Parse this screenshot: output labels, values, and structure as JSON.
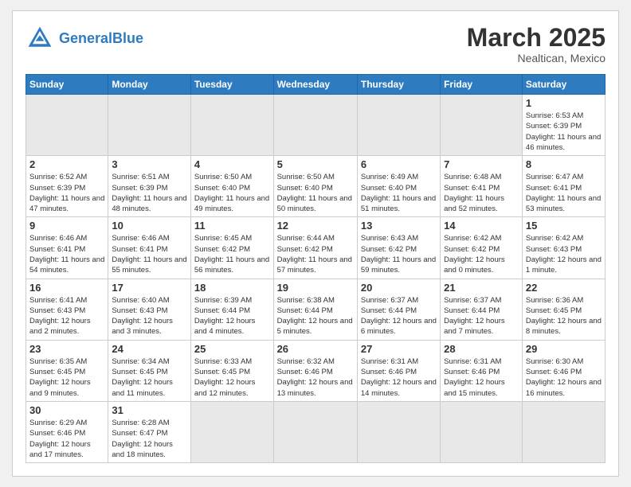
{
  "header": {
    "logo_general": "General",
    "logo_blue": "Blue",
    "month_title": "March 2025",
    "subtitle": "Nealtican, Mexico"
  },
  "weekdays": [
    "Sunday",
    "Monday",
    "Tuesday",
    "Wednesday",
    "Thursday",
    "Friday",
    "Saturday"
  ],
  "weeks": [
    [
      {
        "day": "",
        "empty": true
      },
      {
        "day": "",
        "empty": true
      },
      {
        "day": "",
        "empty": true
      },
      {
        "day": "",
        "empty": true
      },
      {
        "day": "",
        "empty": true
      },
      {
        "day": "",
        "empty": true
      },
      {
        "day": "1",
        "sunrise": "6:53 AM",
        "sunset": "6:39 PM",
        "daylight": "11 hours and 46 minutes."
      }
    ],
    [
      {
        "day": "2",
        "sunrise": "6:52 AM",
        "sunset": "6:39 PM",
        "daylight": "11 hours and 47 minutes."
      },
      {
        "day": "3",
        "sunrise": "6:51 AM",
        "sunset": "6:39 PM",
        "daylight": "11 hours and 48 minutes."
      },
      {
        "day": "4",
        "sunrise": "6:50 AM",
        "sunset": "6:40 PM",
        "daylight": "11 hours and 49 minutes."
      },
      {
        "day": "5",
        "sunrise": "6:50 AM",
        "sunset": "6:40 PM",
        "daylight": "11 hours and 50 minutes."
      },
      {
        "day": "6",
        "sunrise": "6:49 AM",
        "sunset": "6:40 PM",
        "daylight": "11 hours and 51 minutes."
      },
      {
        "day": "7",
        "sunrise": "6:48 AM",
        "sunset": "6:41 PM",
        "daylight": "11 hours and 52 minutes."
      },
      {
        "day": "8",
        "sunrise": "6:47 AM",
        "sunset": "6:41 PM",
        "daylight": "11 hours and 53 minutes."
      }
    ],
    [
      {
        "day": "9",
        "sunrise": "6:46 AM",
        "sunset": "6:41 PM",
        "daylight": "11 hours and 54 minutes."
      },
      {
        "day": "10",
        "sunrise": "6:46 AM",
        "sunset": "6:41 PM",
        "daylight": "11 hours and 55 minutes."
      },
      {
        "day": "11",
        "sunrise": "6:45 AM",
        "sunset": "6:42 PM",
        "daylight": "11 hours and 56 minutes."
      },
      {
        "day": "12",
        "sunrise": "6:44 AM",
        "sunset": "6:42 PM",
        "daylight": "11 hours and 57 minutes."
      },
      {
        "day": "13",
        "sunrise": "6:43 AM",
        "sunset": "6:42 PM",
        "daylight": "11 hours and 59 minutes."
      },
      {
        "day": "14",
        "sunrise": "6:42 AM",
        "sunset": "6:42 PM",
        "daylight": "12 hours and 0 minutes."
      },
      {
        "day": "15",
        "sunrise": "6:42 AM",
        "sunset": "6:43 PM",
        "daylight": "12 hours and 1 minute."
      }
    ],
    [
      {
        "day": "16",
        "sunrise": "6:41 AM",
        "sunset": "6:43 PM",
        "daylight": "12 hours and 2 minutes."
      },
      {
        "day": "17",
        "sunrise": "6:40 AM",
        "sunset": "6:43 PM",
        "daylight": "12 hours and 3 minutes."
      },
      {
        "day": "18",
        "sunrise": "6:39 AM",
        "sunset": "6:44 PM",
        "daylight": "12 hours and 4 minutes."
      },
      {
        "day": "19",
        "sunrise": "6:38 AM",
        "sunset": "6:44 PM",
        "daylight": "12 hours and 5 minutes."
      },
      {
        "day": "20",
        "sunrise": "6:37 AM",
        "sunset": "6:44 PM",
        "daylight": "12 hours and 6 minutes."
      },
      {
        "day": "21",
        "sunrise": "6:37 AM",
        "sunset": "6:44 PM",
        "daylight": "12 hours and 7 minutes."
      },
      {
        "day": "22",
        "sunrise": "6:36 AM",
        "sunset": "6:45 PM",
        "daylight": "12 hours and 8 minutes."
      }
    ],
    [
      {
        "day": "23",
        "sunrise": "6:35 AM",
        "sunset": "6:45 PM",
        "daylight": "12 hours and 9 minutes."
      },
      {
        "day": "24",
        "sunrise": "6:34 AM",
        "sunset": "6:45 PM",
        "daylight": "12 hours and 11 minutes."
      },
      {
        "day": "25",
        "sunrise": "6:33 AM",
        "sunset": "6:45 PM",
        "daylight": "12 hours and 12 minutes."
      },
      {
        "day": "26",
        "sunrise": "6:32 AM",
        "sunset": "6:46 PM",
        "daylight": "12 hours and 13 minutes."
      },
      {
        "day": "27",
        "sunrise": "6:31 AM",
        "sunset": "6:46 PM",
        "daylight": "12 hours and 14 minutes."
      },
      {
        "day": "28",
        "sunrise": "6:31 AM",
        "sunset": "6:46 PM",
        "daylight": "12 hours and 15 minutes."
      },
      {
        "day": "29",
        "sunrise": "6:30 AM",
        "sunset": "6:46 PM",
        "daylight": "12 hours and 16 minutes."
      }
    ],
    [
      {
        "day": "30",
        "sunrise": "6:29 AM",
        "sunset": "6:46 PM",
        "daylight": "12 hours and 17 minutes."
      },
      {
        "day": "31",
        "sunrise": "6:28 AM",
        "sunset": "6:47 PM",
        "daylight": "12 hours and 18 minutes."
      },
      {
        "day": "",
        "empty": true
      },
      {
        "day": "",
        "empty": true
      },
      {
        "day": "",
        "empty": true
      },
      {
        "day": "",
        "empty": true
      },
      {
        "day": "",
        "empty": true
      }
    ]
  ]
}
